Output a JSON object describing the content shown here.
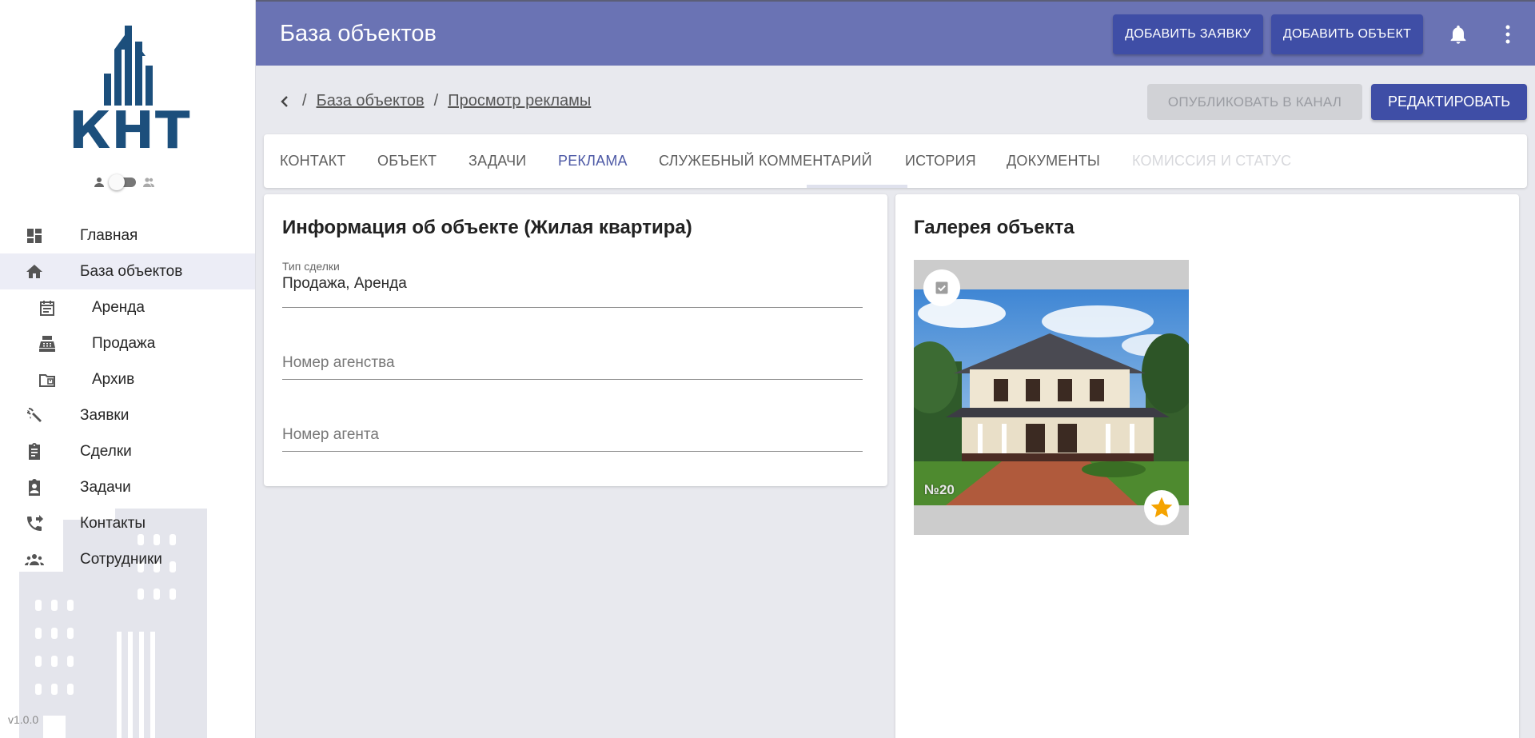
{
  "app": {
    "logo_text": "КНТ",
    "version": "v1.0.0"
  },
  "sidebar": {
    "items": [
      {
        "label": "Главная",
        "icon": "dashboard-icon"
      },
      {
        "label": "База объектов",
        "icon": "home-icon",
        "active": true
      },
      {
        "label": "Аренда",
        "icon": "calendar-icon",
        "sub": true
      },
      {
        "label": "Продажа",
        "icon": "cash-register-icon",
        "sub": true
      },
      {
        "label": "Архив",
        "icon": "archive-folder-icon",
        "sub": true
      },
      {
        "label": "Заявки",
        "icon": "request-icon"
      },
      {
        "label": "Сделки",
        "icon": "clipboard-icon"
      },
      {
        "label": "Задачи",
        "icon": "assignment-ind-icon"
      },
      {
        "label": "Контакты",
        "icon": "phone-forwarded-icon"
      },
      {
        "label": "Сотрудники",
        "icon": "people-icon"
      }
    ]
  },
  "header": {
    "title": "База объектов",
    "add_request_label": "ДОБАВИТЬ ЗАЯВКУ",
    "add_object_label": "ДОБАВИТЬ ОБЪЕКТ"
  },
  "breadcrumb": {
    "separator": "/",
    "items": [
      "База объектов",
      "Просмотр рекламы"
    ]
  },
  "actions": {
    "publish_label": "ОПУБЛИКОВАТЬ В КАНАЛ",
    "edit_label": "РЕДАКТИРОВАТЬ"
  },
  "tabs": [
    {
      "label": "КОНТАКТ"
    },
    {
      "label": "ОБЪЕКТ"
    },
    {
      "label": "ЗАДАЧИ"
    },
    {
      "label": "РЕКЛАМА",
      "active": true
    },
    {
      "label": "СЛУЖЕБНЫЙ КОММЕНТАРИЙ"
    },
    {
      "label": "ИСТОРИЯ"
    },
    {
      "label": "ДОКУМЕНТЫ"
    },
    {
      "label": "КОМИССИЯ И СТАТУС",
      "disabled": true
    }
  ],
  "info": {
    "title": "Информация об объекте (Жилая квартира)",
    "deal_type_label": "Тип сделки",
    "deal_type_value": "Продажа, Аренда",
    "agency_number_placeholder": "Номер агенства",
    "agent_number_placeholder": "Номер агента"
  },
  "gallery": {
    "title": "Галерея объекта",
    "photo_number": "№20"
  },
  "colors": {
    "appbar": "#6a73b4",
    "primary_button": "#3f4ea6",
    "active_tab": "#4e5aa6",
    "logo": "#1c4f7c",
    "star": "#f5a300"
  }
}
